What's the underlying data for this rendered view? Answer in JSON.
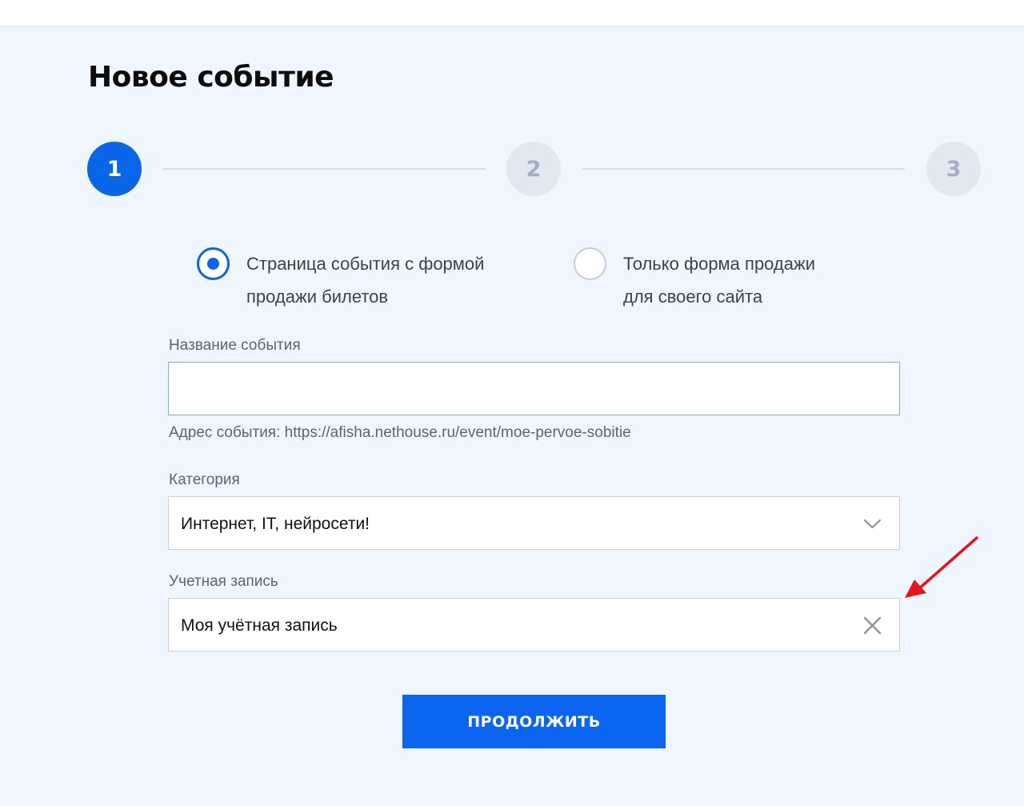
{
  "page": {
    "title": "Новое событие"
  },
  "stepper": {
    "steps": [
      "1",
      "2",
      "3"
    ],
    "active_step": 1
  },
  "event_type": {
    "options": [
      {
        "label": "Страница события с формой\nпродажи билетов",
        "checked": true
      },
      {
        "label": "Только форма продажи\nдля своего сайта",
        "checked": false
      }
    ]
  },
  "event_name": {
    "label": "Название события",
    "value": "",
    "placeholder": ""
  },
  "event_address": {
    "hint": "Адрес события: https://afisha.nethouse.ru/event/moe-pervoe-sobitie"
  },
  "category": {
    "label": "Категория",
    "value": "Интернет, IT, нейросети!"
  },
  "account": {
    "label": "Учетная запись",
    "value": "Моя учётная запись"
  },
  "actions": {
    "continue_label": "ПРОДОЛЖИТЬ"
  },
  "colors": {
    "accent": "#0a66e8",
    "background": "#eff6fd",
    "step_inactive": "#e2e8f0",
    "annotation_arrow": "#e8141c"
  },
  "icons": {
    "category_toggle": "chevron-down-icon",
    "account_clear": "close-icon",
    "annotation": "red-arrow-annotation"
  }
}
